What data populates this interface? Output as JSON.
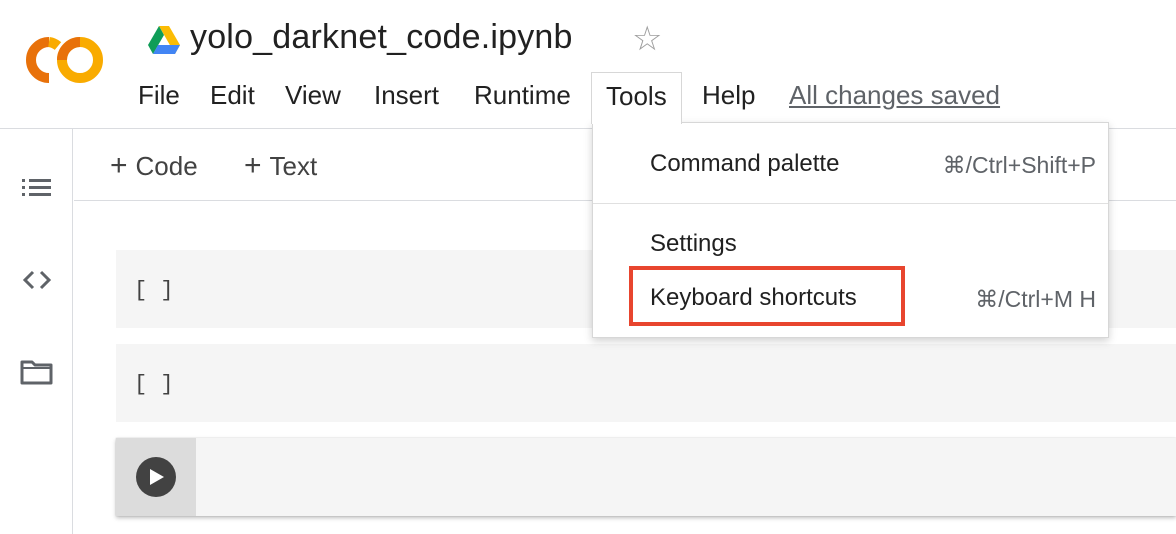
{
  "app": {
    "logo_text": "CO",
    "notebook_title": "yolo_darknet_code.ipynb",
    "star_icon": "star-outline-icon",
    "colors": {
      "logo_orange": "#f9ab00",
      "logo_dark_orange": "#e8710a",
      "highlight_red": "#e8452e"
    }
  },
  "menu": {
    "items": [
      {
        "label": "File"
      },
      {
        "label": "Edit"
      },
      {
        "label": "View"
      },
      {
        "label": "Insert"
      },
      {
        "label": "Runtime"
      },
      {
        "label": "Tools",
        "active": true
      },
      {
        "label": "Help"
      }
    ],
    "save_status": "All changes saved"
  },
  "rail": {
    "icons": [
      "table-of-contents-icon",
      "code-snippets-icon",
      "files-folder-icon"
    ]
  },
  "toolbar": {
    "add_code_label": "Code",
    "add_text_label": "Text",
    "plus_glyph": "+"
  },
  "cells": [
    {
      "prompt": "[ ]"
    },
    {
      "prompt": "[ ]"
    },
    {
      "prompt": "",
      "focused": true,
      "run_icon": "play-icon"
    }
  ],
  "tools_menu": {
    "items": [
      {
        "label": "Command palette",
        "shortcut": "⌘/Ctrl+Shift+P"
      },
      {
        "label": "Settings",
        "shortcut": ""
      },
      {
        "label": "Keyboard shortcuts",
        "shortcut": "⌘/Ctrl+M H",
        "highlighted": true
      }
    ]
  }
}
